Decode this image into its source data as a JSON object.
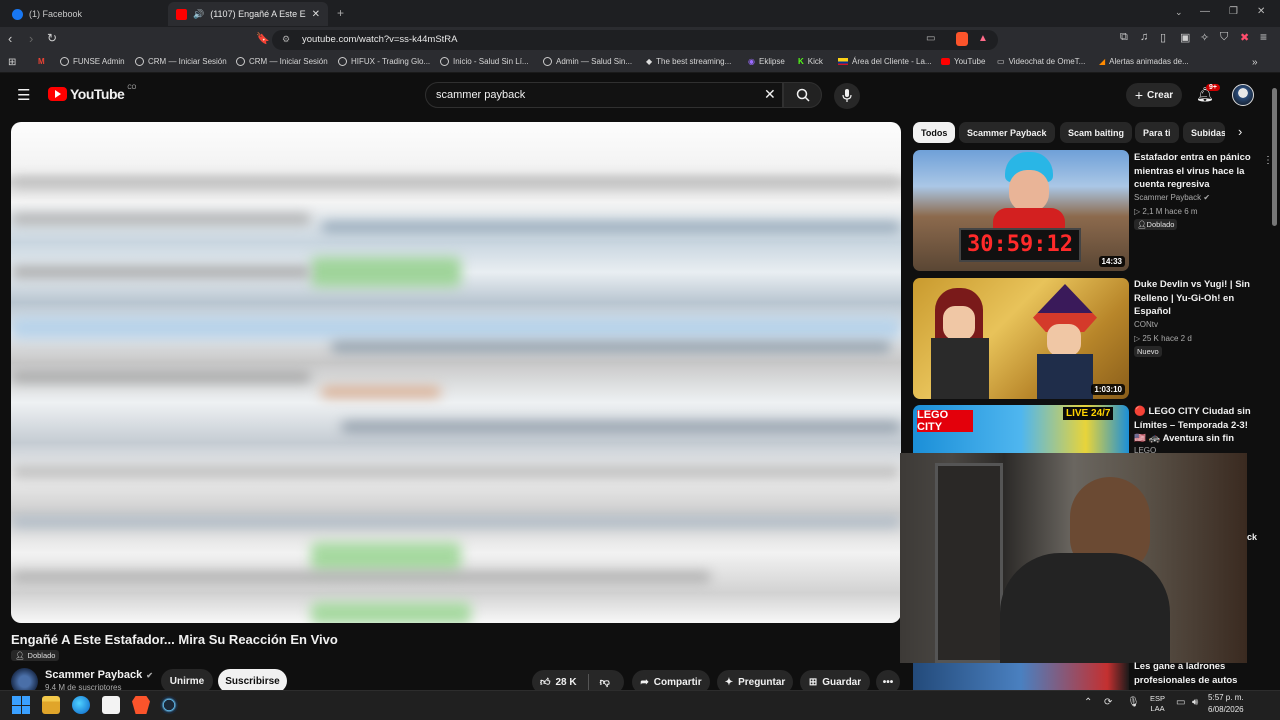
{
  "browser": {
    "tabs": [
      {
        "label": "(1) Facebook",
        "active": false
      },
      {
        "label": "(1107) Engañé A Este Estafad",
        "active": true
      }
    ],
    "new_tab": "+",
    "url": "youtube.com/watch?v=ss-k44mStRA",
    "bookmarks": [
      "FUNSE Admin",
      "CRM — Iniciar Sesión",
      "CRM — Iniciar Sesión",
      "HIFUX - Trading Glo...",
      "Inicio - Salud Sin Lí...",
      "Admin — Salud Sin...",
      "The best streaming...",
      "Eklipse",
      "Kick",
      "Área del Cliente - La...",
      "YouTube",
      "Videochat de OmeT...",
      "Alertas animadas de..."
    ]
  },
  "youtube": {
    "logo": "YouTube",
    "country": "CO",
    "search_value": "scammer payback",
    "create_label": "Crear",
    "notif_count": "9+",
    "chips": [
      "Todos",
      "Scammer Payback",
      "Scam baiting",
      "Para ti",
      "Subidas"
    ],
    "video": {
      "title": "Engañé A Este Estafador... Mira Su Reacción En Vivo",
      "dubbed": "Doblado",
      "channel": "Scammer Payback",
      "subscribers": "9,4 M de suscriptores",
      "join": "Unirme",
      "subscribe": "Suscribirse",
      "likes": "28 K",
      "share": "Compartir",
      "ask": "Preguntar",
      "save": "Guardar"
    },
    "recommendations": [
      {
        "title": "Estafador entra en pánico mientras el virus hace la cuenta regresiva",
        "channel": "Scammer Payback",
        "meta": "2,1 M  hace 6 m",
        "badge": "Doblado",
        "duration": "14:33",
        "timer": "30:59:12"
      },
      {
        "title": "Duke Devlin vs Yugi! | Sin Relleno | Yu-Gi-Oh! en Español",
        "channel": "CONtv",
        "meta": "25 K  hace 2 d",
        "badge": "Nuevo",
        "duration": "1:03:10"
      },
      {
        "title": "🔴 LEGO CITY Ciudad sin Límites – Temporada 2-3! 🇺🇸 🚓 Aventura sin fin",
        "channel": "LEGO",
        "thumb_text_a": "LEGO CITY",
        "thumb_text_b": "LIVE 24/7"
      },
      {
        "title": "Les gane a ladrones profesionales de autos"
      }
    ],
    "partial_text": "ck"
  },
  "taskbar": {
    "lang": "ESP",
    "lang2": "LAA",
    "time": "5:57 p. m.",
    "date": "6/08/2026"
  }
}
